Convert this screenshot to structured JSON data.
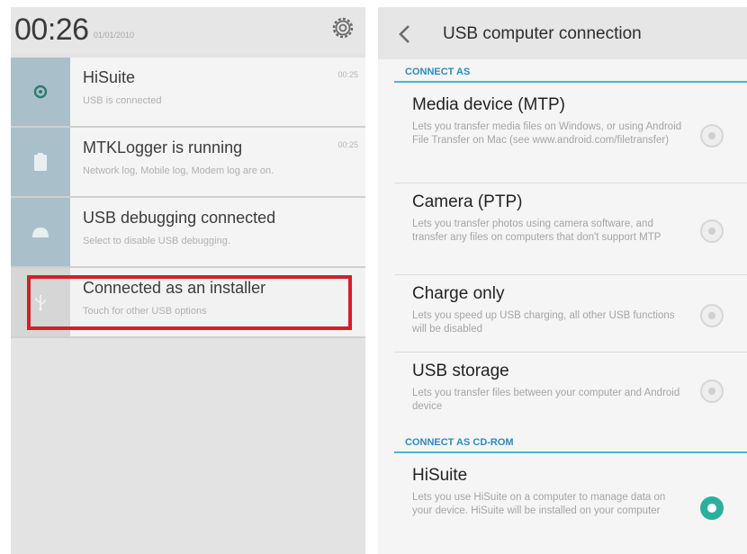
{
  "notification_shade": {
    "clock": "00:26",
    "date": "01/01/2010",
    "notifications": [
      {
        "title": "HiSuite",
        "subtitle": "USB is connected",
        "time": "00:25",
        "icon": "hisuite-icon"
      },
      {
        "title": "MTKLogger is running",
        "subtitle": "Network log, Mobile log, Modem log are on.",
        "time": "00:25",
        "icon": "clipboard-icon"
      },
      {
        "title": "USB debugging connected",
        "subtitle": "Select to disable USB debugging.",
        "time": "",
        "icon": "android-icon"
      },
      {
        "title": "Connected as an installer",
        "subtitle": "Touch for other USB options",
        "time": "",
        "icon": "usb-icon",
        "highlighted": true
      }
    ],
    "highlight_color": "#d21f2b"
  },
  "usb_settings": {
    "title": "USB computer connection",
    "sections": [
      {
        "header": "CONNECT AS",
        "options": [
          {
            "title": "Media device (MTP)",
            "description": "Lets you transfer media files on Windows, or using Android File Transfer on Mac (see www.android.com/filetransfer)",
            "selected": false
          },
          {
            "title": "Camera (PTP)",
            "description": "Lets you transfer photos using camera software, and transfer any files on computers that don't support MTP",
            "selected": false
          },
          {
            "title": "Charge only",
            "description": "Lets you speed up USB charging, all other USB functions will be disabled",
            "selected": false
          },
          {
            "title": "USB storage",
            "description": "Lets you transfer files between your computer and Android device",
            "selected": false
          }
        ]
      },
      {
        "header": "CONNECT AS CD-ROM",
        "options": [
          {
            "title": "HiSuite",
            "description": "Lets you use HiSuite on a computer to manage data on your device. HiSuite will be installed on your computer",
            "selected": true
          }
        ]
      }
    ],
    "accent_color": "#2ab09d",
    "header_color": "#2b8bbf"
  }
}
